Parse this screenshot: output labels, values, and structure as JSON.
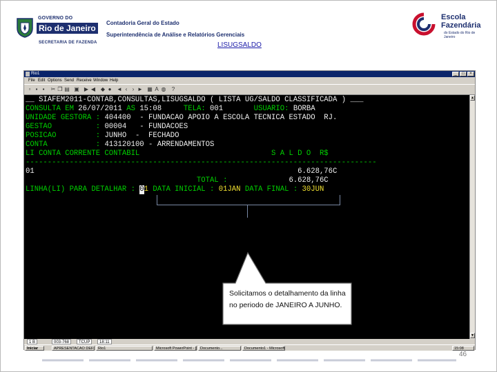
{
  "header": {
    "gov_top": "GOVERNO DO",
    "gov_name": "Rio de Janeiro",
    "secretaria": "SECRETARIA DE FAZENDA",
    "line1": "Contadoria Geral do Estado",
    "line2": "Superintendência de Análise e Relatórios Gerenciais",
    "slide_title": "LISUGSALDO",
    "school_l1": "Escola",
    "school_l2": "Fazendária",
    "school_l3": "do Estado do Rio de Janeiro"
  },
  "window": {
    "title": "Rio1",
    "menu": [
      "File",
      "Edit",
      "Options",
      "Send",
      "Receive",
      "Window",
      "Help"
    ],
    "buttons": {
      "minimize": "_",
      "maximize": "□",
      "close": "×"
    }
  },
  "terminal": {
    "l1_a": "__ SIAFEM2011-CONTAB,CONSULTAS,LISUGSALDO ( LISTA UG/SALDO CLASSIFICADA ) ___",
    "l2_a": "CONSULTA EM ",
    "l2_b": "26/07/2011",
    "l2_c": " AS ",
    "l2_d": "15:08",
    "l2_e": "     TELA: ",
    "l2_f": "001",
    "l2_g": "       USUARIO: ",
    "l2_h": "BORBA",
    "l3_a": "UNIDADE GESTORA : ",
    "l3_b": "404400  - FUNDACAO APOIO A ESCOLA TECNICA ESTADO  RJ.",
    "l4_a": "GESTAO          : ",
    "l4_b": "00004   - FUNDACOES",
    "l5_a": "POSICAO         : ",
    "l5_b": "JUNHO  -  FECHADO",
    "l6_a": "CONTA           : ",
    "l6_b": "413120100 - ARRENDAMENTOS",
    "l7_a": "LI CONTA CORRENTE CONTABIL",
    "l7_b": "                              S A L D O  R$",
    "l8_a": "--------------------------------------------------------------------------------",
    "l9_a": "01",
    "l9_b": "                                                            6.628,76C",
    "l10_a": "                                       TOTAL :",
    "l10_b": "              6.628,76C",
    "l11_a": "LINHA(LI) PARA DETALHAR : ",
    "l11_c": "0",
    "l11_d": "1",
    "l11_e": " DATA INICIAL : ",
    "l11_f": "01JAN",
    "l11_g": " DATA FINAL : ",
    "l11_h": "30JUN"
  },
  "statusbar": {
    "s1": "1 B",
    "s2": "003-768",
    "s3": "TCUP",
    "s4": "18:11"
  },
  "taskbar": {
    "start": "Iniciar",
    "tasks": [
      "APRESENTACAO DEFINI...",
      "Rio1",
      "Microsoft PowerPoint - [...",
      "Documento... ",
      "Documento1 - Microsoft ..."
    ],
    "clock": "15:08"
  },
  "callout": {
    "text": "Solicitamos o detalhamento da linha no periodo de JANEIRO A JUNHO."
  },
  "page_number": "46",
  "colors": {
    "terminal_bg": "#000000",
    "terminal_green": "#00d000",
    "terminal_yellow": "#f0e030",
    "brand_blue": "#1d2f6f"
  }
}
